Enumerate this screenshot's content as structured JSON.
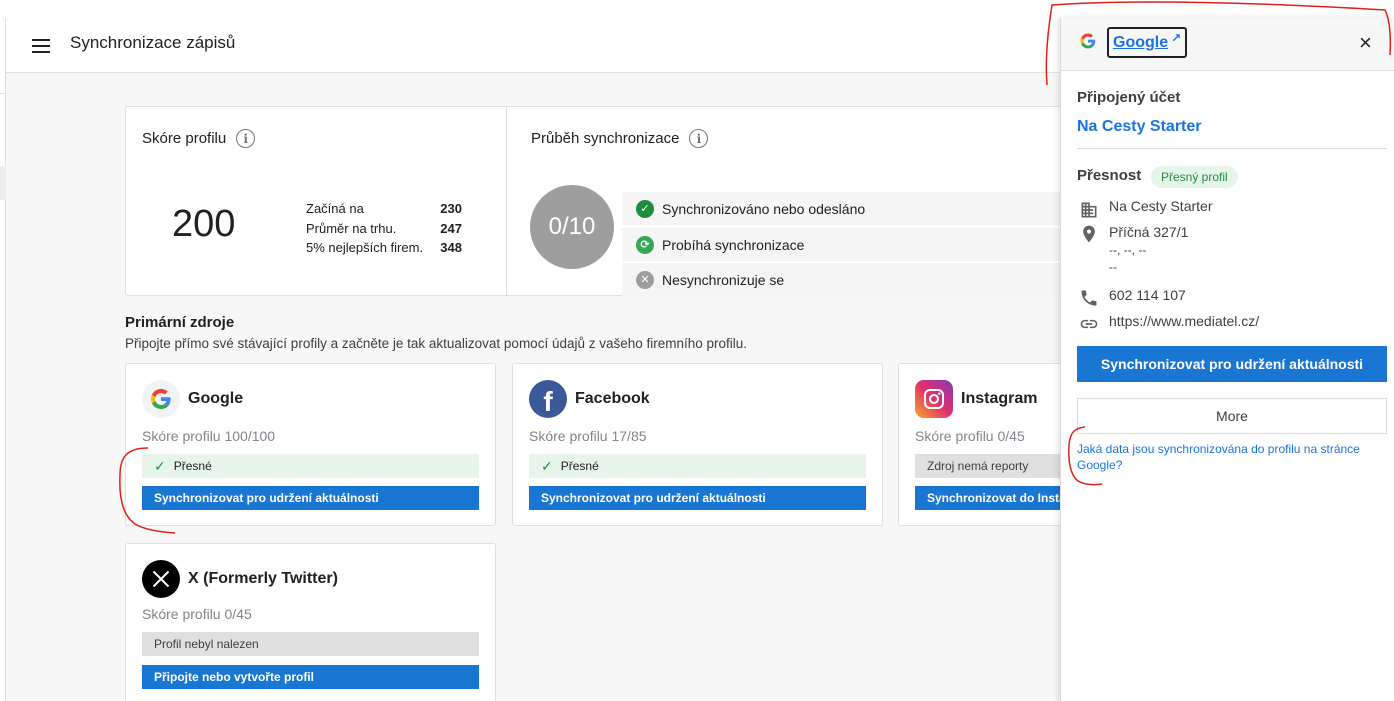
{
  "header": {
    "title": "Synchronizace zápisů"
  },
  "profile_score": {
    "title": "Skóre profilu",
    "score": "200",
    "stats": [
      {
        "label": "Začíná na",
        "value": "230"
      },
      {
        "label": "Průměr na trhu.",
        "value": "247"
      },
      {
        "label": "5% nejlepších firem.",
        "value": "348"
      }
    ]
  },
  "sync_progress": {
    "title": "Průběh synchronizace",
    "value": "0/10",
    "legend": [
      {
        "label": "Synchronizováno nebo odesláno",
        "icon": "check-circle-icon",
        "color": "#1e8e3e"
      },
      {
        "label": "Probíhá synchronizace",
        "icon": "sync-icon",
        "color": "#34a853"
      },
      {
        "label": "Nesynchronizuje se",
        "icon": "x-circle-icon",
        "color": "#9e9e9e"
      }
    ]
  },
  "primary_sources": {
    "title": "Primární zdroje",
    "subtitle": "Připojte přímo své stávající profily a začněte je tak aktualizovat pomocí údajů z vašeho firemního profilu.",
    "cards": [
      {
        "name": "Google",
        "score": "Skóre profilu 100/100",
        "status": "Přesné",
        "status_ok": true,
        "action": "Synchronizovat pro udržení aktuálnosti"
      },
      {
        "name": "Facebook",
        "score": "Skóre profilu 17/85",
        "status": "Přesné",
        "status_ok": true,
        "action": "Synchronizovat pro udržení aktuálnosti"
      },
      {
        "name": "Instagram",
        "score": "Skóre profilu 0/45",
        "status": "Zdroj nemá reporty",
        "status_ok": false,
        "action": "Synchronizovat do Instagramu"
      },
      {
        "name": "X (Formerly Twitter)",
        "score": "Skóre profilu 0/45",
        "status": "Profil nebyl nalezen",
        "status_ok": false,
        "action": "Připojte nebo vytvořte profil"
      }
    ]
  },
  "panel": {
    "g_letter": "G",
    "link_label": "Google",
    "ext_icon": "↗",
    "close": "×",
    "connected_label": "Připojený účet",
    "connected_account": "Na Cesty Starter",
    "accuracy_label": "Přesnost",
    "accuracy_badge": "Přesný profil",
    "business_name": "Na Cesty Starter",
    "address_line1": "Příčná 327/1",
    "address_line2": "--, --, --",
    "address_line3": "--",
    "phone": "602 114 107",
    "website": "https://www.mediatel.cz/",
    "sync_button": "Synchronizovat pro udržení aktuálnosti",
    "more_button": "More",
    "faq_link": "Jaká data jsou synchronizována do profilu na stránce Google?"
  },
  "colors": {
    "primary": "#1976d2",
    "link": "#1a73e8",
    "success": "#1e8e3e",
    "annotation": "#e0201a"
  }
}
